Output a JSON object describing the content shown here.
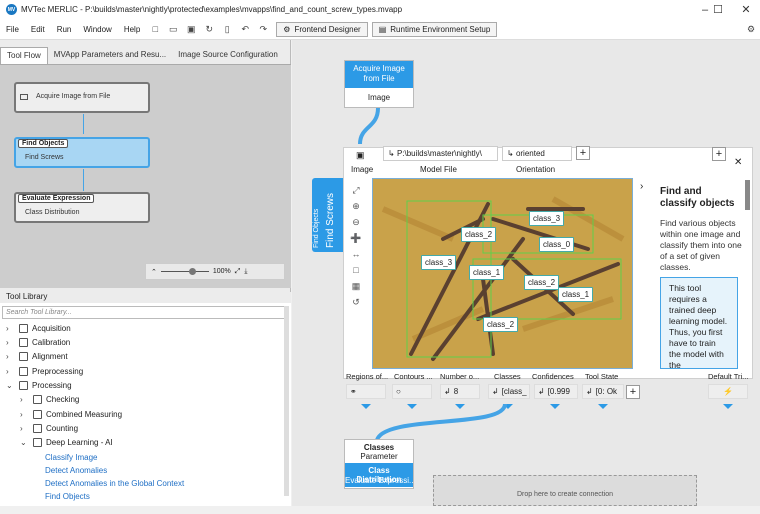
{
  "window": {
    "title": "MVTec MERLIC - P:\\builds\\master\\nightly\\protected\\examples\\mvapps\\find_and_count_screw_types.mvapp",
    "logo": "MV"
  },
  "menu": [
    "File",
    "Edit",
    "Run",
    "Window",
    "Help"
  ],
  "toolbar": {
    "frontend": "Frontend Designer",
    "runtime": "Runtime Environment Setup"
  },
  "tabs": [
    "Tool Flow",
    "MVApp Parameters and Resu...",
    "Image Source Configuration"
  ],
  "flow": {
    "nodes": [
      {
        "label": "Acquire Image from File"
      },
      {
        "head": "Find Objects",
        "sub": "Find Screws"
      },
      {
        "head": "Evaluate Expression",
        "sub": "Class Distribution"
      }
    ],
    "zoom": "100%"
  },
  "library": {
    "title": "Tool Library",
    "search_placeholder": "Search Tool Library...",
    "items": [
      "Acquisition",
      "Calibration",
      "Alignment",
      "Preprocessing",
      "Processing",
      "Checking",
      "Combined Measuring",
      "Counting",
      "Deep Learning - AI",
      "Classify Image",
      "Detect Anomalies",
      "Detect Anomalies in the Global Context",
      "Find Objects"
    ]
  },
  "acquire": {
    "title": "Acquire Image from File",
    "output": "Image"
  },
  "tool": {
    "vertical_small": "Find Objects",
    "vertical_big": "Find Screws",
    "input_image": "Image",
    "model_file_label": "Model File",
    "model_file_value": "P:\\builds\\master\\nightly\\",
    "orientation_label": "Orientation",
    "orientation_value": "oriented",
    "classes": [
      "class_3",
      "class_2",
      "class_0",
      "class_3",
      "class_1",
      "class_2",
      "class_1",
      "class_2"
    ],
    "info_title": "Find and classify objects",
    "info_text": "Find various objects within one image and classify them into one of a set of given classes.",
    "info_note": "This tool requires a trained deep learning model. Thus, you first have to train the model with the",
    "outputs": {
      "headers": [
        "Regions of...",
        "Contours ...",
        "Number o...",
        "Classes",
        "Confidences",
        "Tool State",
        "Default Tri..."
      ],
      "number": "8",
      "classes": "[class_",
      "confidences": "[0.999",
      "tool_state": "[0: Ok"
    }
  },
  "evaluate": {
    "title": "Classes",
    "subtitle": "Parameter",
    "tool": "Class Distribution",
    "tool_sub": "Evaluate Expressi..."
  },
  "drop": "Drop here to create connection"
}
